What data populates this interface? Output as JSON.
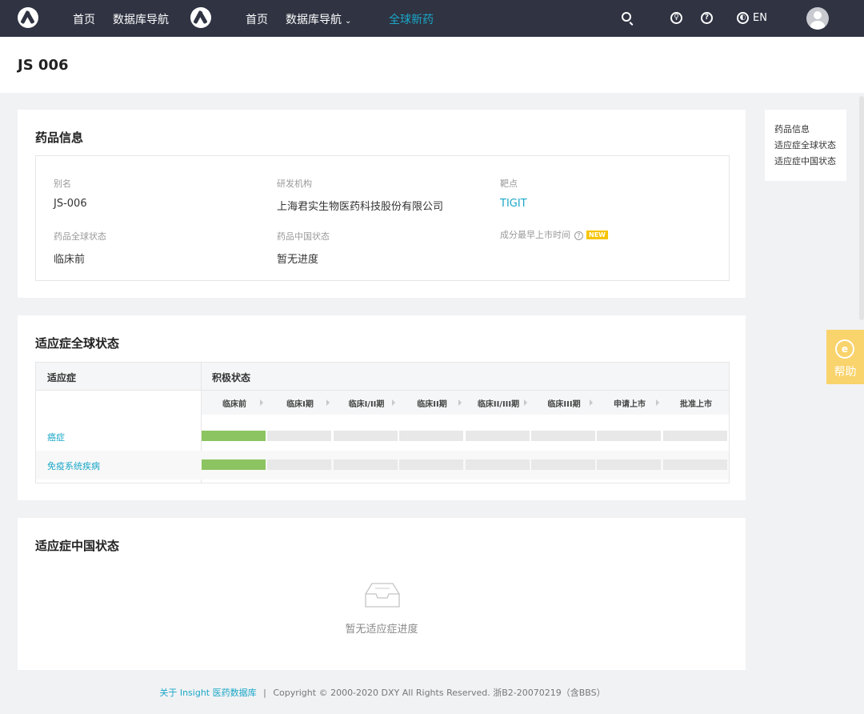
{
  "nav": {
    "links_left": [
      "首页",
      "数据库导航"
    ],
    "links_right": [
      "首页",
      "数据库导航",
      "全球新药"
    ],
    "lang": "EN"
  },
  "page": {
    "title": "JS 006"
  },
  "drug_info": {
    "title": "药品信息",
    "fields": [
      {
        "label": "别名",
        "value": "JS-006"
      },
      {
        "label": "研发机构",
        "value": "上海君实生物医药科技股份有限公司"
      },
      {
        "label": "靶点",
        "value": "TIGIT"
      },
      {
        "label": "药品全球状态",
        "value": "临床前"
      },
      {
        "label": "药品中国状态",
        "value": "暂无进度"
      },
      {
        "label": "成分最早上市时间",
        "value": ""
      }
    ],
    "new_badge": "NEW"
  },
  "global_status": {
    "title": "适应症全球状态",
    "col_indication": "适应症",
    "col_status": "积极状态",
    "stages": [
      "临床前",
      "临床I期",
      "临床I/II期",
      "临床II期",
      "临床II/III期",
      "临床III期",
      "申请上市",
      "批准上市"
    ],
    "rows": [
      {
        "name": "癌症",
        "progress_stages": 1
      },
      {
        "name": "免疫系统疾病",
        "progress_stages": 1
      }
    ],
    "colors": {
      "progress": "#8cc461",
      "empty": "#e8e8e8"
    }
  },
  "china_status": {
    "title": "适应症中国状态",
    "empty_text": "暂无适应症进度"
  },
  "sidenav": [
    "药品信息",
    "适应症全球状态",
    "适应症中国状态"
  ],
  "help": {
    "label": "帮助"
  },
  "footer": {
    "link": "关于 Insight 医药数据库",
    "sep": "|",
    "copyright": "Copyright © 2000-2020 DXY All Rights Reserved. 浙B2-20070219（含BBS）"
  },
  "colors": {
    "nav_bg": "#2f3342",
    "accent": "#1aa7c8",
    "help_bg": "#f9d36b"
  }
}
